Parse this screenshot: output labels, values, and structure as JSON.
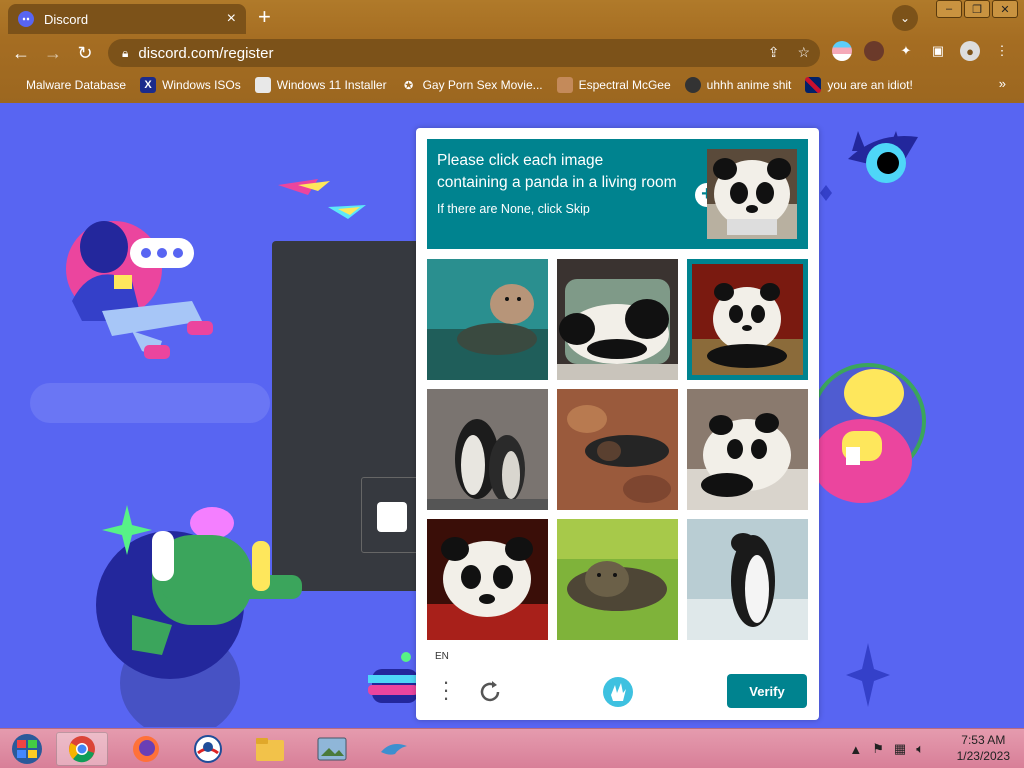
{
  "browser": {
    "tab_title": "Discord",
    "url": "discord.com/register",
    "bookmarks": [
      {
        "label": "Malware Database",
        "icon": "bookmark-malware-icon"
      },
      {
        "label": "Windows ISOs",
        "icon": "x-icon"
      },
      {
        "label": "Windows 11 Installer",
        "icon": "installer-icon"
      },
      {
        "label": "Gay Porn Sex Movie...",
        "icon": "bookmark-icon"
      },
      {
        "label": "Espectral McGee",
        "icon": "avatar-icon"
      },
      {
        "label": "uhhh anime shit",
        "icon": "anime-icon"
      },
      {
        "label": "you are an idiot!",
        "icon": "flag-icon"
      }
    ],
    "more_bookmarks": "»",
    "new_tab": "+",
    "close_tab": "×"
  },
  "captcha": {
    "prompt": "Please click each image containing a panda in a living room",
    "subprompt": "If there are None, click Skip",
    "add_icon": "+",
    "images": [
      {
        "subject": "seal",
        "selected": false
      },
      {
        "subject": "panda",
        "selected": false
      },
      {
        "subject": "panda",
        "selected": true
      },
      {
        "subject": "penguin",
        "selected": false
      },
      {
        "subject": "seal",
        "selected": false
      },
      {
        "subject": "panda",
        "selected": false
      },
      {
        "subject": "panda",
        "selected": false
      },
      {
        "subject": "seal",
        "selected": false
      },
      {
        "subject": "penguin",
        "selected": false
      }
    ],
    "language": "EN",
    "verify_label": "Verify",
    "accent": "#00838f"
  },
  "taskbar": {
    "time": "7:53 AM",
    "date": "1/23/2023",
    "tray_icons": [
      "up-arrow-icon",
      "flag-icon",
      "network-icon",
      "volume-icon"
    ]
  },
  "colors": {
    "discord_blurple": "#5865f2",
    "chrome_theme": "#a56d22",
    "taskbar": "#d87f98"
  }
}
